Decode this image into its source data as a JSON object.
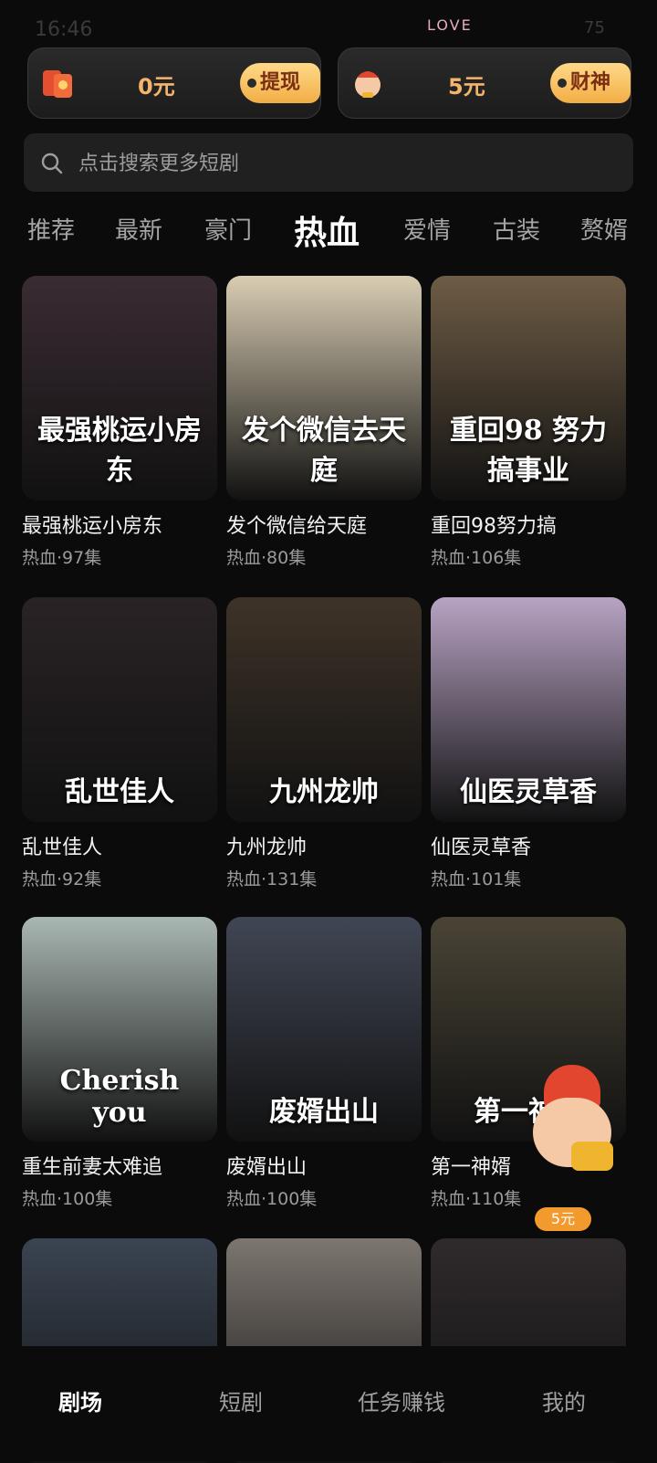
{
  "status": {
    "time": "16:46",
    "decor": "LOVE",
    "battery": "75"
  },
  "earnings": [
    {
      "amount": "0元",
      "action": "提现",
      "icon": "red-envelope-icon"
    },
    {
      "amount": "5元",
      "action": "财神",
      "icon": "fortune-god-icon"
    }
  ],
  "search": {
    "placeholder": "点击搜索更多短剧"
  },
  "categories": [
    "推荐",
    "最新",
    "豪门",
    "热血",
    "爱情",
    "古装",
    "赘婿"
  ],
  "active_category": "热血",
  "dramas": [
    {
      "title": "最强桃运小房东",
      "meta": "热血·97集",
      "poster_text": "最强桃运小房东",
      "color": "#3a2c33"
    },
    {
      "title": "发个微信给天庭",
      "meta": "热血·80集",
      "poster_text": "发个微信去天庭",
      "color": "#d9cdb3"
    },
    {
      "title": "重回98努力搞",
      "meta": "热血·106集",
      "poster_text": "重回98 努力搞事业",
      "color": "#6e5c45"
    },
    {
      "title": "乱世佳人",
      "meta": "热血·92集",
      "poster_text": "乱世佳人",
      "color": "#2a2325"
    },
    {
      "title": "九州龙帅",
      "meta": "热血·131集",
      "poster_text": "九州龙帅",
      "color": "#3e3328"
    },
    {
      "title": "仙医灵草香",
      "meta": "热血·101集",
      "poster_text": "仙医灵草香",
      "color": "#b8a3c4"
    },
    {
      "title": "重生前妻太难追",
      "meta": "热血·100集",
      "poster_text": "Cherish you",
      "color": "#a9b7b2"
    },
    {
      "title": "废婿出山",
      "meta": "热血·100集",
      "poster_text": "废婿出山",
      "color": "#404654"
    },
    {
      "title": "第一神婿",
      "meta": "热血·110集",
      "poster_text": "第一神婿",
      "color": "#4a4436"
    },
    {
      "title": "",
      "meta": "",
      "poster_text": "",
      "color": "#3a4452"
    },
    {
      "title": "",
      "meta": "",
      "poster_text": "",
      "color": "#7d7670"
    },
    {
      "title": "",
      "meta": "",
      "poster_text": "",
      "color": "#2f2a2c"
    }
  ],
  "floating_badge": "5元",
  "bottom_nav": [
    "剧场",
    "短剧",
    "任务赚钱",
    "我的"
  ],
  "active_nav": "剧场"
}
